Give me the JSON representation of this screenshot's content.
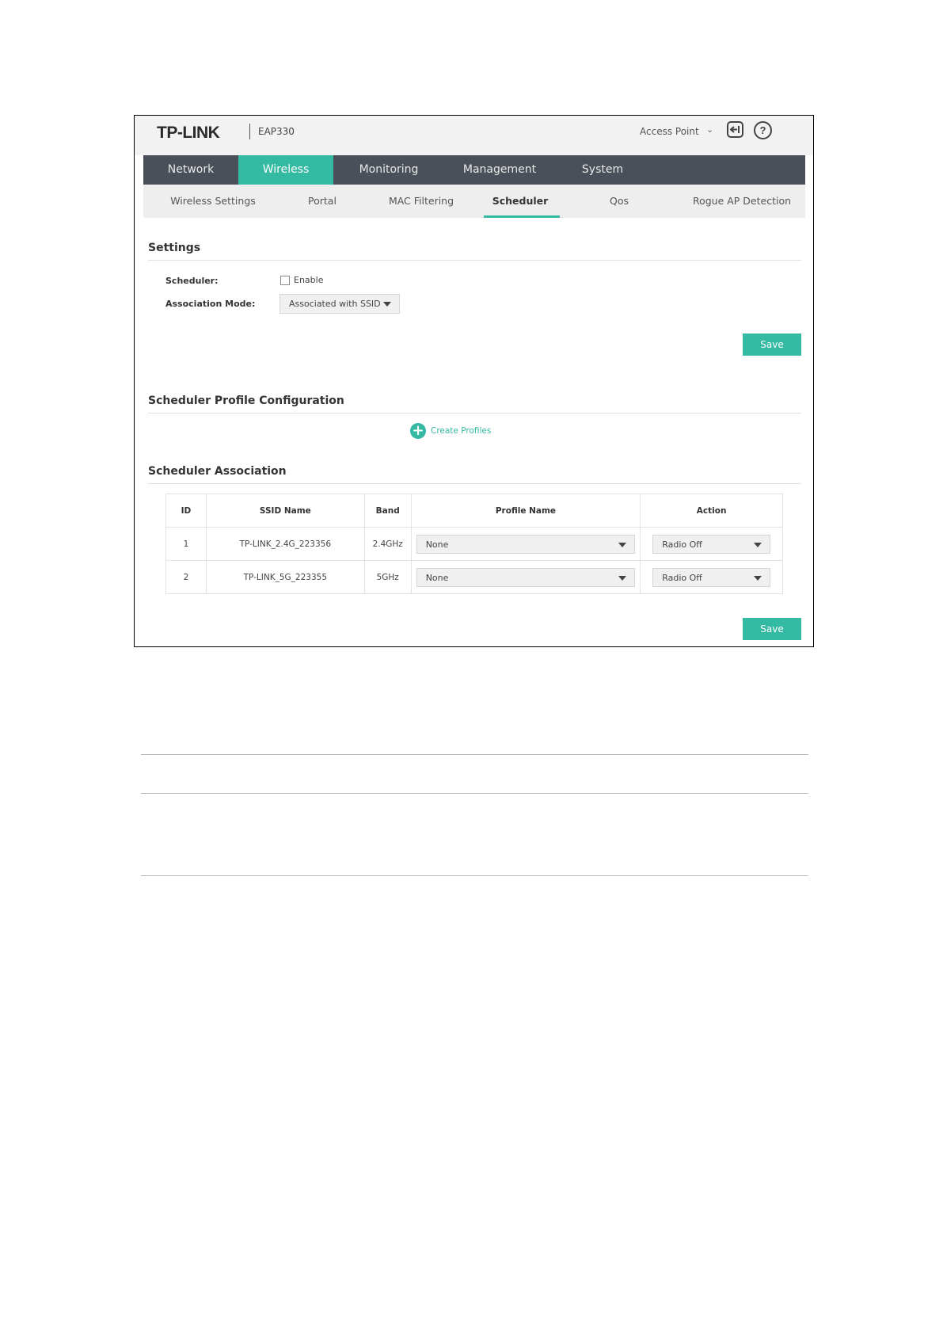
{
  "header": {
    "logo": "TP-LINK",
    "model": "EAP330",
    "mode": "Access Point",
    "mode_chevron": "⌄",
    "icons": [
      "logout-icon",
      "help-icon"
    ],
    "help_glyph": "?"
  },
  "main_nav": [
    {
      "label": "Network",
      "active": false
    },
    {
      "label": "Wireless",
      "active": true
    },
    {
      "label": "Monitoring",
      "active": false
    },
    {
      "label": "Management",
      "active": false
    },
    {
      "label": "System",
      "active": false
    }
  ],
  "sub_nav": [
    {
      "label": "Wireless Settings",
      "active": false
    },
    {
      "label": "Portal",
      "active": false
    },
    {
      "label": "MAC Filtering",
      "active": false
    },
    {
      "label": "Scheduler",
      "active": true
    },
    {
      "label": "Qos",
      "active": false
    },
    {
      "label": "Rogue AP Detection",
      "active": false
    }
  ],
  "settings": {
    "title": "Settings",
    "scheduler_label": "Scheduler:",
    "enable_label": "Enable",
    "enable_checked": false,
    "association_mode_label": "Association Mode:",
    "association_mode_value": "Associated with SSID",
    "save_label": "Save"
  },
  "profile_config": {
    "title": "Scheduler Profile Configuration",
    "create_label": "Create Profiles"
  },
  "association": {
    "title": "Scheduler Association",
    "columns": [
      "ID",
      "SSID Name",
      "Band",
      "Profile Name",
      "Action"
    ],
    "rows": [
      {
        "id": "1",
        "ssid": "TP-LINK_2.4G_223356",
        "band": "2.4GHz",
        "profile": "None",
        "action": "Radio Off"
      },
      {
        "id": "2",
        "ssid": "TP-LINK_5G_223355",
        "band": "5GHz",
        "profile": "None",
        "action": "Radio Off"
      }
    ],
    "save_label": "Save"
  },
  "colors": {
    "accent": "#34b9a2",
    "nav_bg": "#4a5059",
    "subnav_bg": "#eeeeee"
  }
}
